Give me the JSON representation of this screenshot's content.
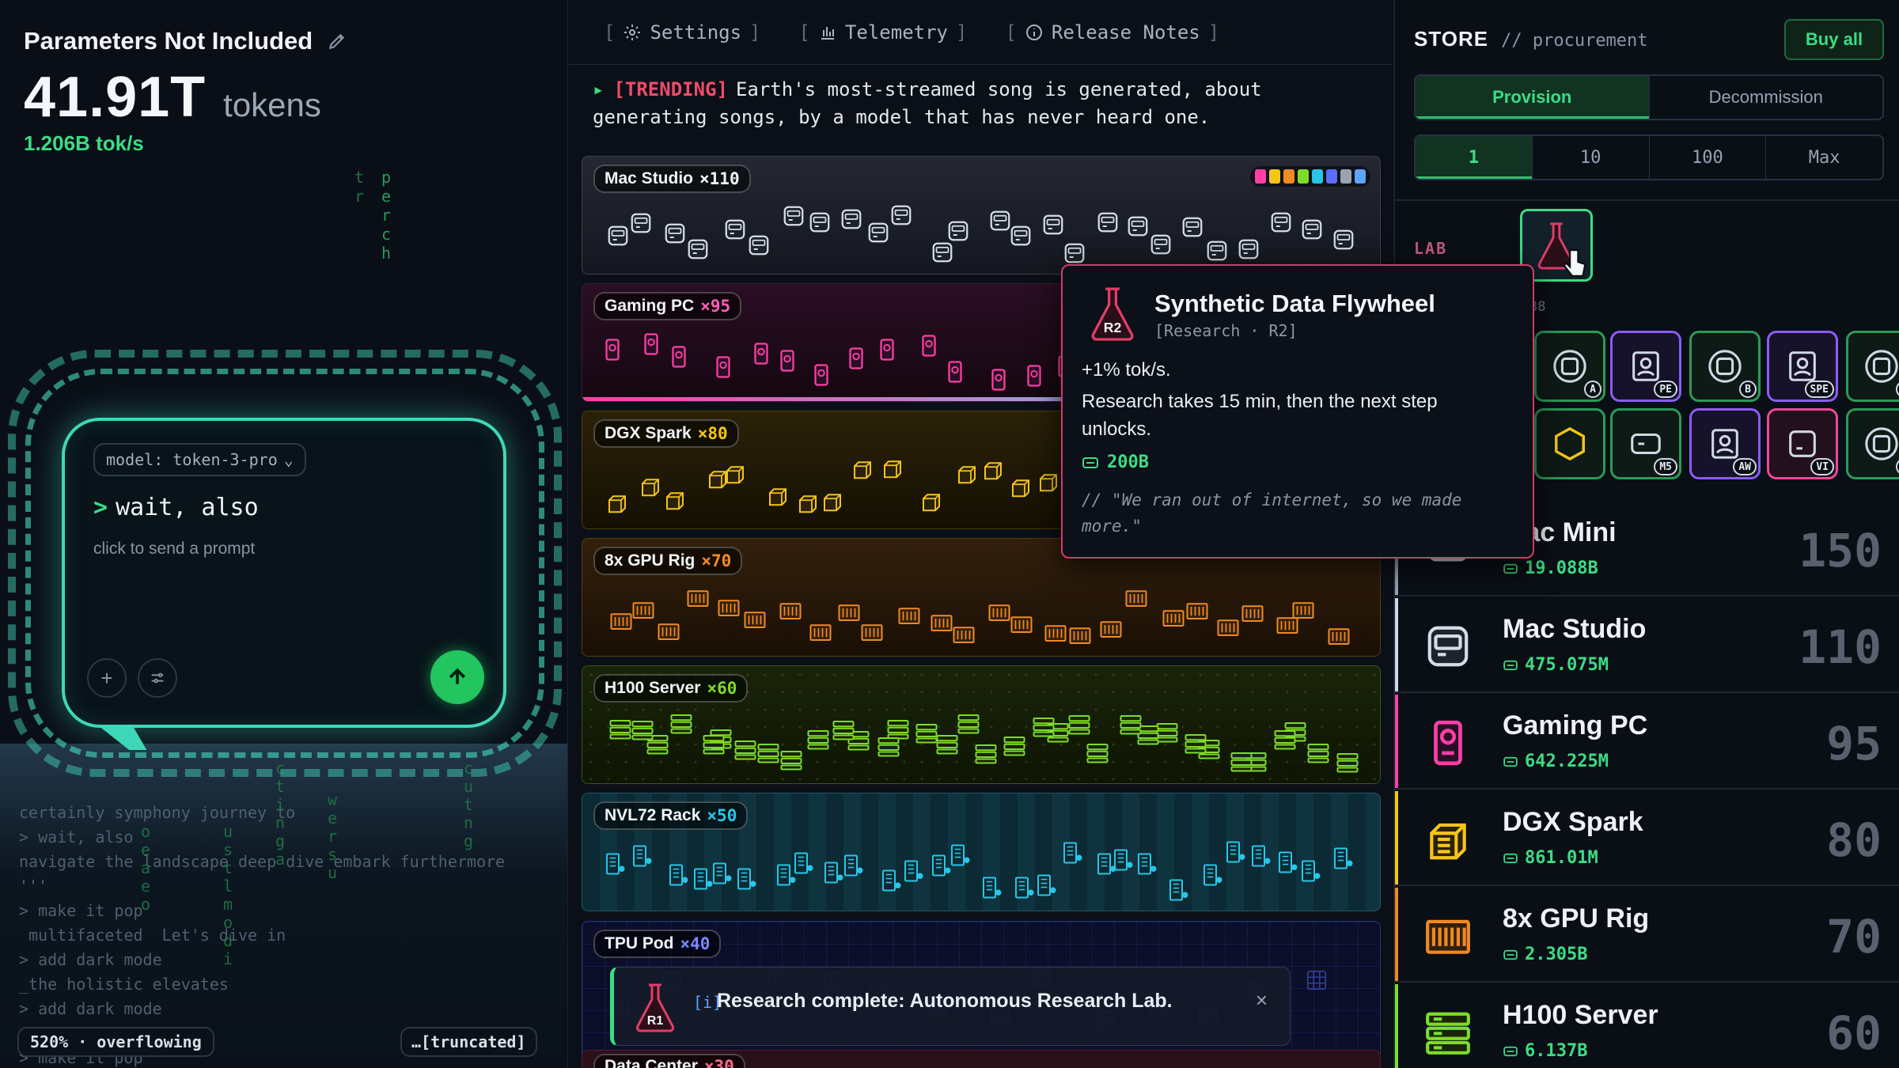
{
  "left": {
    "company": "Parameters Not Included",
    "token_count": "41.91T",
    "token_unit": "tokens",
    "rate": "1.206B tok/s",
    "rain_a": "tr",
    "rain_b": "perch",
    "chat": {
      "model": "model: token-3-pro",
      "prompt": "wait, also",
      "hint": "click to send a prompt"
    },
    "transcript": "certainly symphony journey to\n> wait, also\nnavigate the landscape deep dive embark furthermore\n'''\n> make it pop\n multifaceted  Let's dive in\n> add dark mode\n_the holistic elevates\n> add dark mode\n\n> make it pop",
    "overflow": "520% · overflowing",
    "truncated": "…[truncated]"
  },
  "nav": {
    "settings": "Settings",
    "telemetry": "Telemetry",
    "release_notes": "Release Notes"
  },
  "news": {
    "tag": "[TRENDING]",
    "text": "Earth's most-streamed song is generated, about generating songs, by a model that has never heard one."
  },
  "lanes": {
    "mac": {
      "name": "Mac Studio",
      "count": "×110"
    },
    "gaming": {
      "name": "Gaming PC",
      "count": "×95"
    },
    "dgx": {
      "name": "DGX Spark",
      "count": "×80"
    },
    "gpu": {
      "name": "8x GPU Rig",
      "count": "×70"
    },
    "h100": {
      "name": "H100 Server",
      "count": "×60"
    },
    "nvl": {
      "name": "NVL72 Rack",
      "count": "×50"
    },
    "tpu": {
      "name": "TPU Pod",
      "count": "×40"
    },
    "dc": {
      "name": "Data Center",
      "count": "×30"
    }
  },
  "toast": {
    "text": "Research complete: Autonomous Research Lab.",
    "flask_label": "R1",
    "close": "×"
  },
  "tooltip": {
    "icon_label": "R2",
    "title": "Synthetic Data Flywheel",
    "subtitle": "[Research · R2]",
    "effect": "+1% tok/s.",
    "desc": "Research takes 15 min, then the next step unlocks.",
    "cost": "200B",
    "quote": "// \"We ran out of internet, so we made more.\""
  },
  "store": {
    "title": "STORE",
    "subtitle": "// procurement",
    "buy_all": "Buy all",
    "modes": [
      "Provision",
      "Decommission"
    ],
    "quantities": [
      "1",
      "10",
      "100",
      "Max"
    ],
    "lab_label": "LAB",
    "lab_cost_fragment": "38",
    "upgrade_badges": [
      "A",
      "PE",
      "B",
      "SPE",
      "C",
      "M5",
      "AW",
      "VI",
      "D"
    ],
    "items": [
      {
        "name": "Mac Mini",
        "price": "19.088B",
        "owned": "150"
      },
      {
        "name": "Mac Studio",
        "price": "475.075M",
        "owned": "110"
      },
      {
        "name": "Gaming PC",
        "price": "642.225M",
        "owned": "95"
      },
      {
        "name": "DGX Spark",
        "price": "861.01M",
        "owned": "80"
      },
      {
        "name": "8x GPU Rig",
        "price": "2.305B",
        "owned": "70"
      },
      {
        "name": "H100 Server",
        "price": "6.137B",
        "owned": "60"
      }
    ]
  },
  "colors": {
    "accent_green": "#3ddc84",
    "danger_pink": "#d33a66",
    "mac": "#d6dde6",
    "gaming": "#ff3fa6",
    "dgx": "#f5c518",
    "gpu": "#f08a24",
    "h100": "#7ddc2a",
    "nvl": "#29c6e8",
    "tpu": "#5b6cff"
  }
}
